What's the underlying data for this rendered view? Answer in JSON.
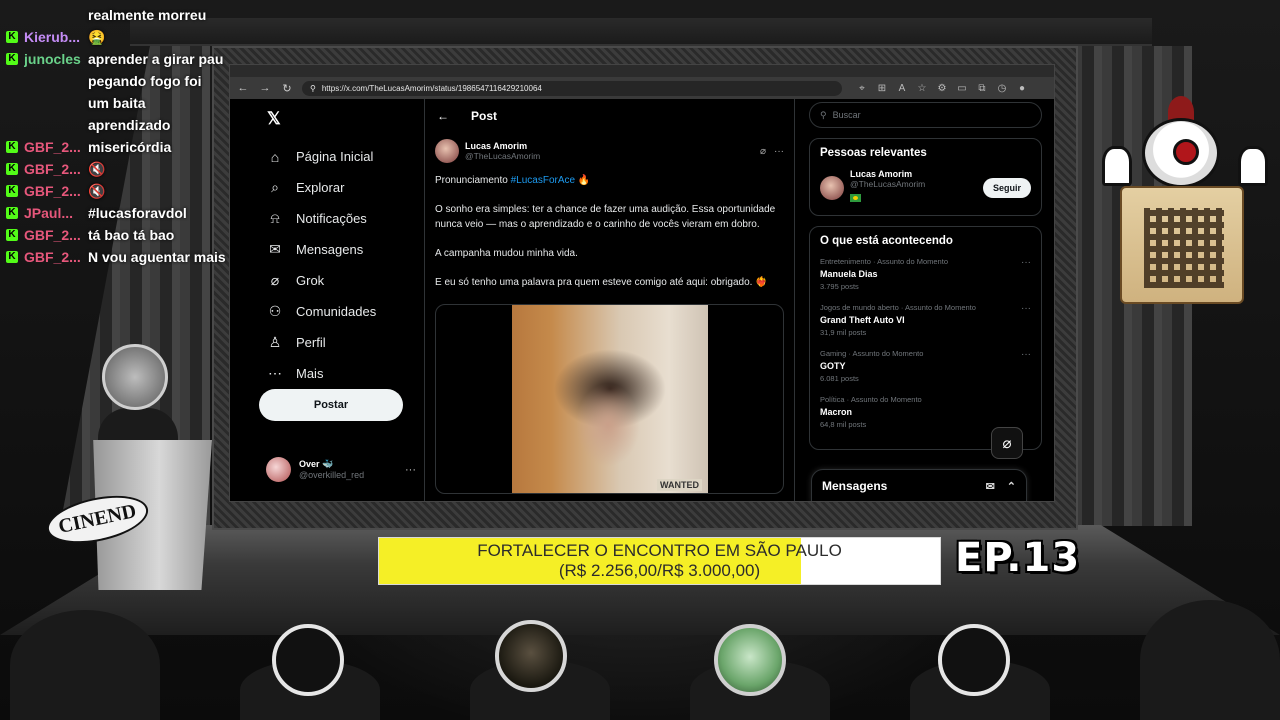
{
  "chat": [
    {
      "user": "",
      "color": "",
      "message": "realmente morreu",
      "badge": false
    },
    {
      "user": "Kierub...",
      "color": "#c48cf5",
      "message": "🤮",
      "badge": true
    },
    {
      "user": "junocles",
      "color": "#6ad28a",
      "message": "aprender a girar pau pegando fogo foi um baita aprendizado",
      "badge": true
    },
    {
      "user": "GBF_2...",
      "color": "#e6577b",
      "message": "misericórdia",
      "badge": true
    },
    {
      "user": "GBF_2...",
      "color": "#e6577b",
      "message": "🔇",
      "badge": true
    },
    {
      "user": "GBF_2...",
      "color": "#e6577b",
      "message": "🔇",
      "badge": true
    },
    {
      "user": "JPaul...",
      "color": "#e6577b",
      "message": "#lucasforavdol",
      "badge": true
    },
    {
      "user": "GBF_2...",
      "color": "#e6577b",
      "message": "tá bao tá bao",
      "badge": true
    },
    {
      "user": "GBF_2...",
      "color": "#e6577b",
      "message": "N vou aguentar mais",
      "badge": true
    }
  ],
  "browser": {
    "url": "https://x.com/TheLucasAmorim/status/1986547116429210064"
  },
  "x": {
    "nav": [
      {
        "icon": "home-icon",
        "glyph": "⌂",
        "label": "Página Inicial"
      },
      {
        "icon": "search-icon",
        "glyph": "⌕",
        "label": "Explorar"
      },
      {
        "icon": "bell-icon",
        "glyph": "⍾",
        "label": "Notificações"
      },
      {
        "icon": "mail-icon",
        "glyph": "✉",
        "label": "Mensagens"
      },
      {
        "icon": "grok-icon",
        "glyph": "⌀",
        "label": "Grok"
      },
      {
        "icon": "communities-icon",
        "glyph": "⚇",
        "label": "Comunidades"
      },
      {
        "icon": "profile-icon",
        "glyph": "♙",
        "label": "Perfil"
      },
      {
        "icon": "more-icon",
        "glyph": "⋯",
        "label": "Mais"
      }
    ],
    "post_button": "Postar",
    "account": {
      "name": "Over 🐳",
      "handle": "@overkilled_red"
    },
    "post_header": "Post",
    "tweet": {
      "name": "Lucas Amorim",
      "handle": "@TheLucasAmorim",
      "line1_prefix": "Pronunciamento ",
      "hashtag": "#LucasForAce",
      "line1_suffix": " 🔥",
      "p2": "O sonho era simples: ter a chance de fazer uma audição. Essa oportunidade nunca veio — mas o aprendizado e o carinho de vocês vieram em dobro.",
      "p3": "A campanha mudou minha vida.",
      "p4": "E eu só tenho uma palavra pra quem esteve comigo até aqui: obrigado. ❤️‍🔥",
      "video_sign": "WANTED"
    },
    "search_placeholder": "Buscar",
    "relevant": {
      "title": "Pessoas relevantes",
      "name": "Lucas Amorim",
      "handle": "@TheLucasAmorim",
      "follow": "Seguir"
    },
    "trends": {
      "title": "O que está acontecendo",
      "items": [
        {
          "category": "Entretenimento · Assunto do Momento",
          "title": "Manuela Dias",
          "count": "3.795 posts"
        },
        {
          "category": "Jogos de mundo aberto · Assunto do Momento",
          "title": "Grand Theft Auto VI",
          "count": "31,9 mil posts"
        },
        {
          "category": "Gaming · Assunto do Momento",
          "title": "GOTY",
          "count": "6.081 posts"
        },
        {
          "category": "Política · Assunto do Momento",
          "title": "Macron",
          "count": "64,8 mil posts"
        }
      ]
    },
    "messages_drawer": "Mensagens"
  },
  "banner": {
    "line1": "FORTALECER O ENCONTRO EM SÃO PAULO",
    "line2": "(R$ 2.256,00/R$ 3.000,00)",
    "progress": 0.752,
    "fill_color": "#f5ef26"
  },
  "episode": "EP.13",
  "podium_logo": "CINEND"
}
